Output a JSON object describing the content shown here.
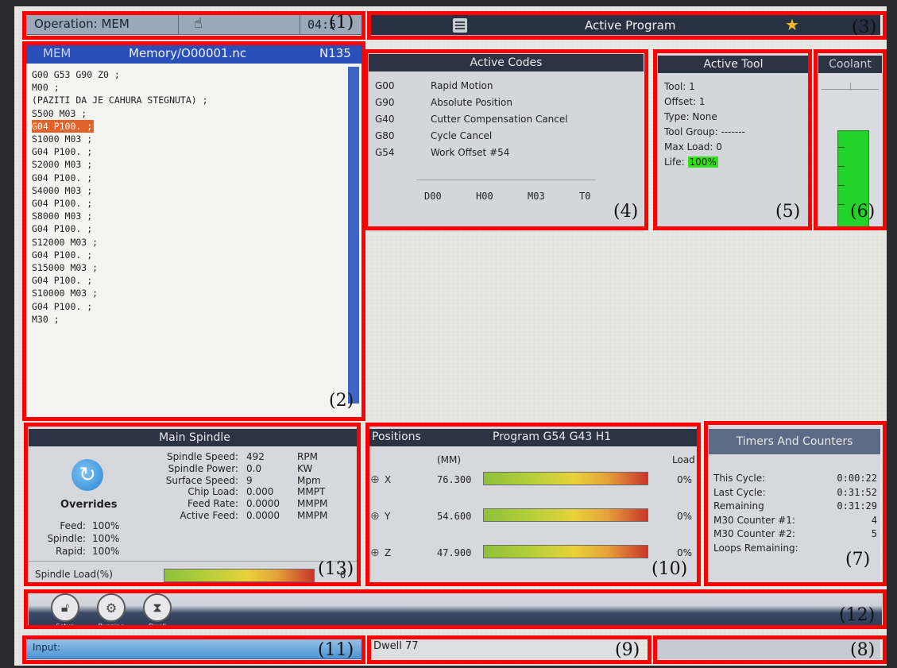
{
  "status_bar": {
    "operation": "Operation: MEM",
    "time": "04:5",
    "label": "(1)"
  },
  "program": {
    "mode": "MEM",
    "path": "Memory/O00001.nc",
    "line": "N135",
    "lines": [
      "G00 G53 G90 Z0 ;",
      "M00 ;",
      "(PAZITI DA JE CAHURA STEGNUTA) ;",
      "S500 M03 ;",
      "G04 P100. ;",
      "S1000 M03 ;",
      "G04 P100. ;",
      "S2000 M03 ;",
      "G04 P100. ;",
      "S4000 M03 ;",
      "G04 P100. ;",
      "S8000 M03 ;",
      "G04 P100. ;",
      "S12000 M03 ;",
      "G04 P100. ;",
      "S15000 M03 ;",
      "G04 P100. ;",
      "S10000 M03 ;",
      "G04 P100. ;",
      "M30 ;"
    ],
    "highlighted_line": 4,
    "label": "(2)"
  },
  "active_program": {
    "title": "Active Program",
    "label": "(3)"
  },
  "active_codes": {
    "title": "Active Codes",
    "codes": [
      {
        "code": "G00",
        "desc": "Rapid Motion"
      },
      {
        "code": "G90",
        "desc": "Absolute Position"
      },
      {
        "code": "G40",
        "desc": "Cutter Compensation Cancel"
      },
      {
        "code": "G80",
        "desc": "Cycle Cancel"
      },
      {
        "code": "G54",
        "desc": "Work Offset #54"
      }
    ],
    "footer": [
      "D00",
      "H00",
      "M03",
      "T0"
    ],
    "label": "(4)"
  },
  "active_tool": {
    "title": "Active Tool",
    "tool": "Tool: 1",
    "offset": "Offset: 1",
    "type": "Type: None",
    "group": "Tool Group: -------",
    "max_load": "Max Load: 0",
    "life_label": "Life:",
    "life_value": "100%",
    "label": "(5)"
  },
  "coolant": {
    "title": "Coolant",
    "label": "(6)"
  },
  "timers": {
    "title": "Timers And Counters",
    "rows": [
      {
        "name": "This Cycle:",
        "value": "0:00:22"
      },
      {
        "name": "Last Cycle:",
        "value": "0:31:52"
      },
      {
        "name": "Remaining",
        "value": "0:31:29"
      },
      {
        "name": "M30 Counter #1:",
        "value": "4"
      },
      {
        "name": "M30 Counter #2:",
        "value": "5"
      },
      {
        "name": "Loops Remaining:",
        "value": ""
      }
    ],
    "label": "(7)"
  },
  "bottom_right": {
    "label": "(8)"
  },
  "dwell": {
    "text": "Dwell 77",
    "label": "(9)"
  },
  "positions": {
    "title": "Positions",
    "program": "Program G54 G43 H1",
    "unit": "(MM)",
    "load_header": "Load",
    "axes": [
      {
        "axis": "X",
        "value": "76.300",
        "load": "0%"
      },
      {
        "axis": "Y",
        "value": "54.600",
        "load": "0%"
      },
      {
        "axis": "Z",
        "value": "47.900",
        "load": "0%"
      }
    ],
    "label": "(10)"
  },
  "input": {
    "label_text": "Input:",
    "label": "(11)"
  },
  "modes": {
    "buttons": [
      "Setup",
      "Running",
      "Dwell"
    ],
    "label": "(12)"
  },
  "spindle": {
    "title": "Main Spindle",
    "overrides_title": "Overrides",
    "overrides": [
      {
        "name": "Feed:",
        "value": "100%"
      },
      {
        "name": "Spindle:",
        "value": "100%"
      },
      {
        "name": "Rapid:",
        "value": "100%"
      }
    ],
    "stats": [
      {
        "name": "Spindle Speed:",
        "value": "492",
        "unit": "RPM"
      },
      {
        "name": "Spindle Power:",
        "value": "0.0",
        "unit": "KW"
      },
      {
        "name": "Surface Speed:",
        "value": "9",
        "unit": "Mpm"
      },
      {
        "name": "Chip Load:",
        "value": "0.000",
        "unit": "MMPT"
      },
      {
        "name": "Feed Rate:",
        "value": "0.0000",
        "unit": "MMPM"
      },
      {
        "name": "Active Feed:",
        "value": "0.0000",
        "unit": "MMPM"
      }
    ],
    "load_label": "Spindle Load(%)",
    "load_value": "0",
    "label": "(13)"
  },
  "colors": {
    "red_box": "#ff0000",
    "header_dark": "#2c3444",
    "program_header": "#2a4fb8",
    "highlight": "#e2632a",
    "life_green": "#34e01a",
    "coolant_green": "#22d42a"
  }
}
